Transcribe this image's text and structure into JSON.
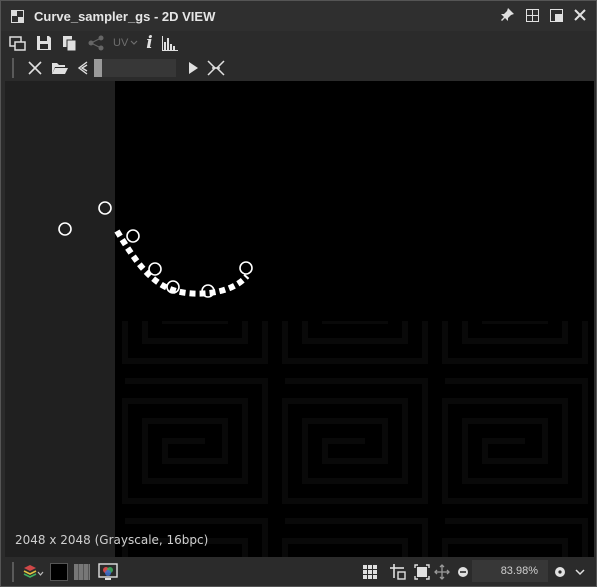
{
  "window": {
    "title": "Curve_sampler_gs - 2D VIEW"
  },
  "toolbar": {
    "uv_label": "UV",
    "info_label": "i"
  },
  "viewport": {
    "dimensions_text": "2048 x 2048 (Grayscale, 16bpc)",
    "background_color": "#000000",
    "left_strip_color": "#202020"
  },
  "bottom": {
    "zoom_value": "83.98%"
  }
}
